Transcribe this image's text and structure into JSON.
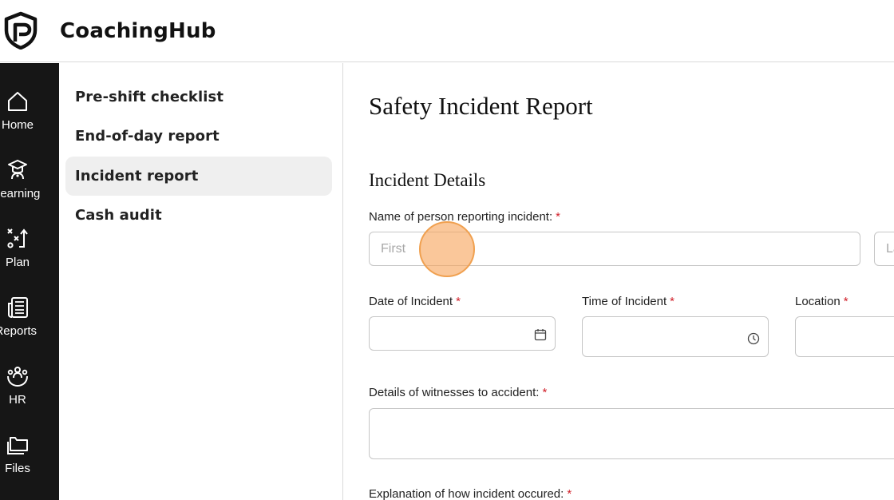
{
  "app": {
    "brand": "CoachingHub"
  },
  "rail": {
    "items": [
      {
        "label": "Home",
        "icon": "home-icon"
      },
      {
        "label": "Learning",
        "icon": "graduation-cap-icon"
      },
      {
        "label": "Plan",
        "icon": "strategy-play-icon"
      },
      {
        "label": "Reports",
        "icon": "newspaper-icon"
      },
      {
        "label": "HR",
        "icon": "people-icon"
      },
      {
        "label": "Files",
        "icon": "folders-icon"
      }
    ]
  },
  "subnav": {
    "items": [
      {
        "label": "Pre-shift checklist",
        "active": false
      },
      {
        "label": "End-of-day report",
        "active": false
      },
      {
        "label": "Incident report",
        "active": true
      },
      {
        "label": "Cash audit",
        "active": false
      }
    ]
  },
  "form": {
    "title": "Safety Incident Report",
    "section": "Incident Details",
    "reporter": {
      "label": "Name of person reporting incident:",
      "required_mark": "*",
      "first_placeholder": "First",
      "last_placeholder": "La"
    },
    "date": {
      "label": "Date of Incident",
      "required_mark": "*",
      "icon": "calendar-icon"
    },
    "time": {
      "label": "Time of Incident",
      "required_mark": "*",
      "icon": "clock-icon"
    },
    "location": {
      "label": "Location",
      "required_mark": "*"
    },
    "witnesses": {
      "label": "Details of witnesses to accident:",
      "required_mark": "*"
    },
    "explanation": {
      "label": "Explanation of how incident occured:",
      "required_mark": "*"
    }
  },
  "colors": {
    "rail_bg": "#161616",
    "active_item_bg": "#efefef",
    "required": "#d1202a",
    "click_marker": "#f7a55c"
  }
}
